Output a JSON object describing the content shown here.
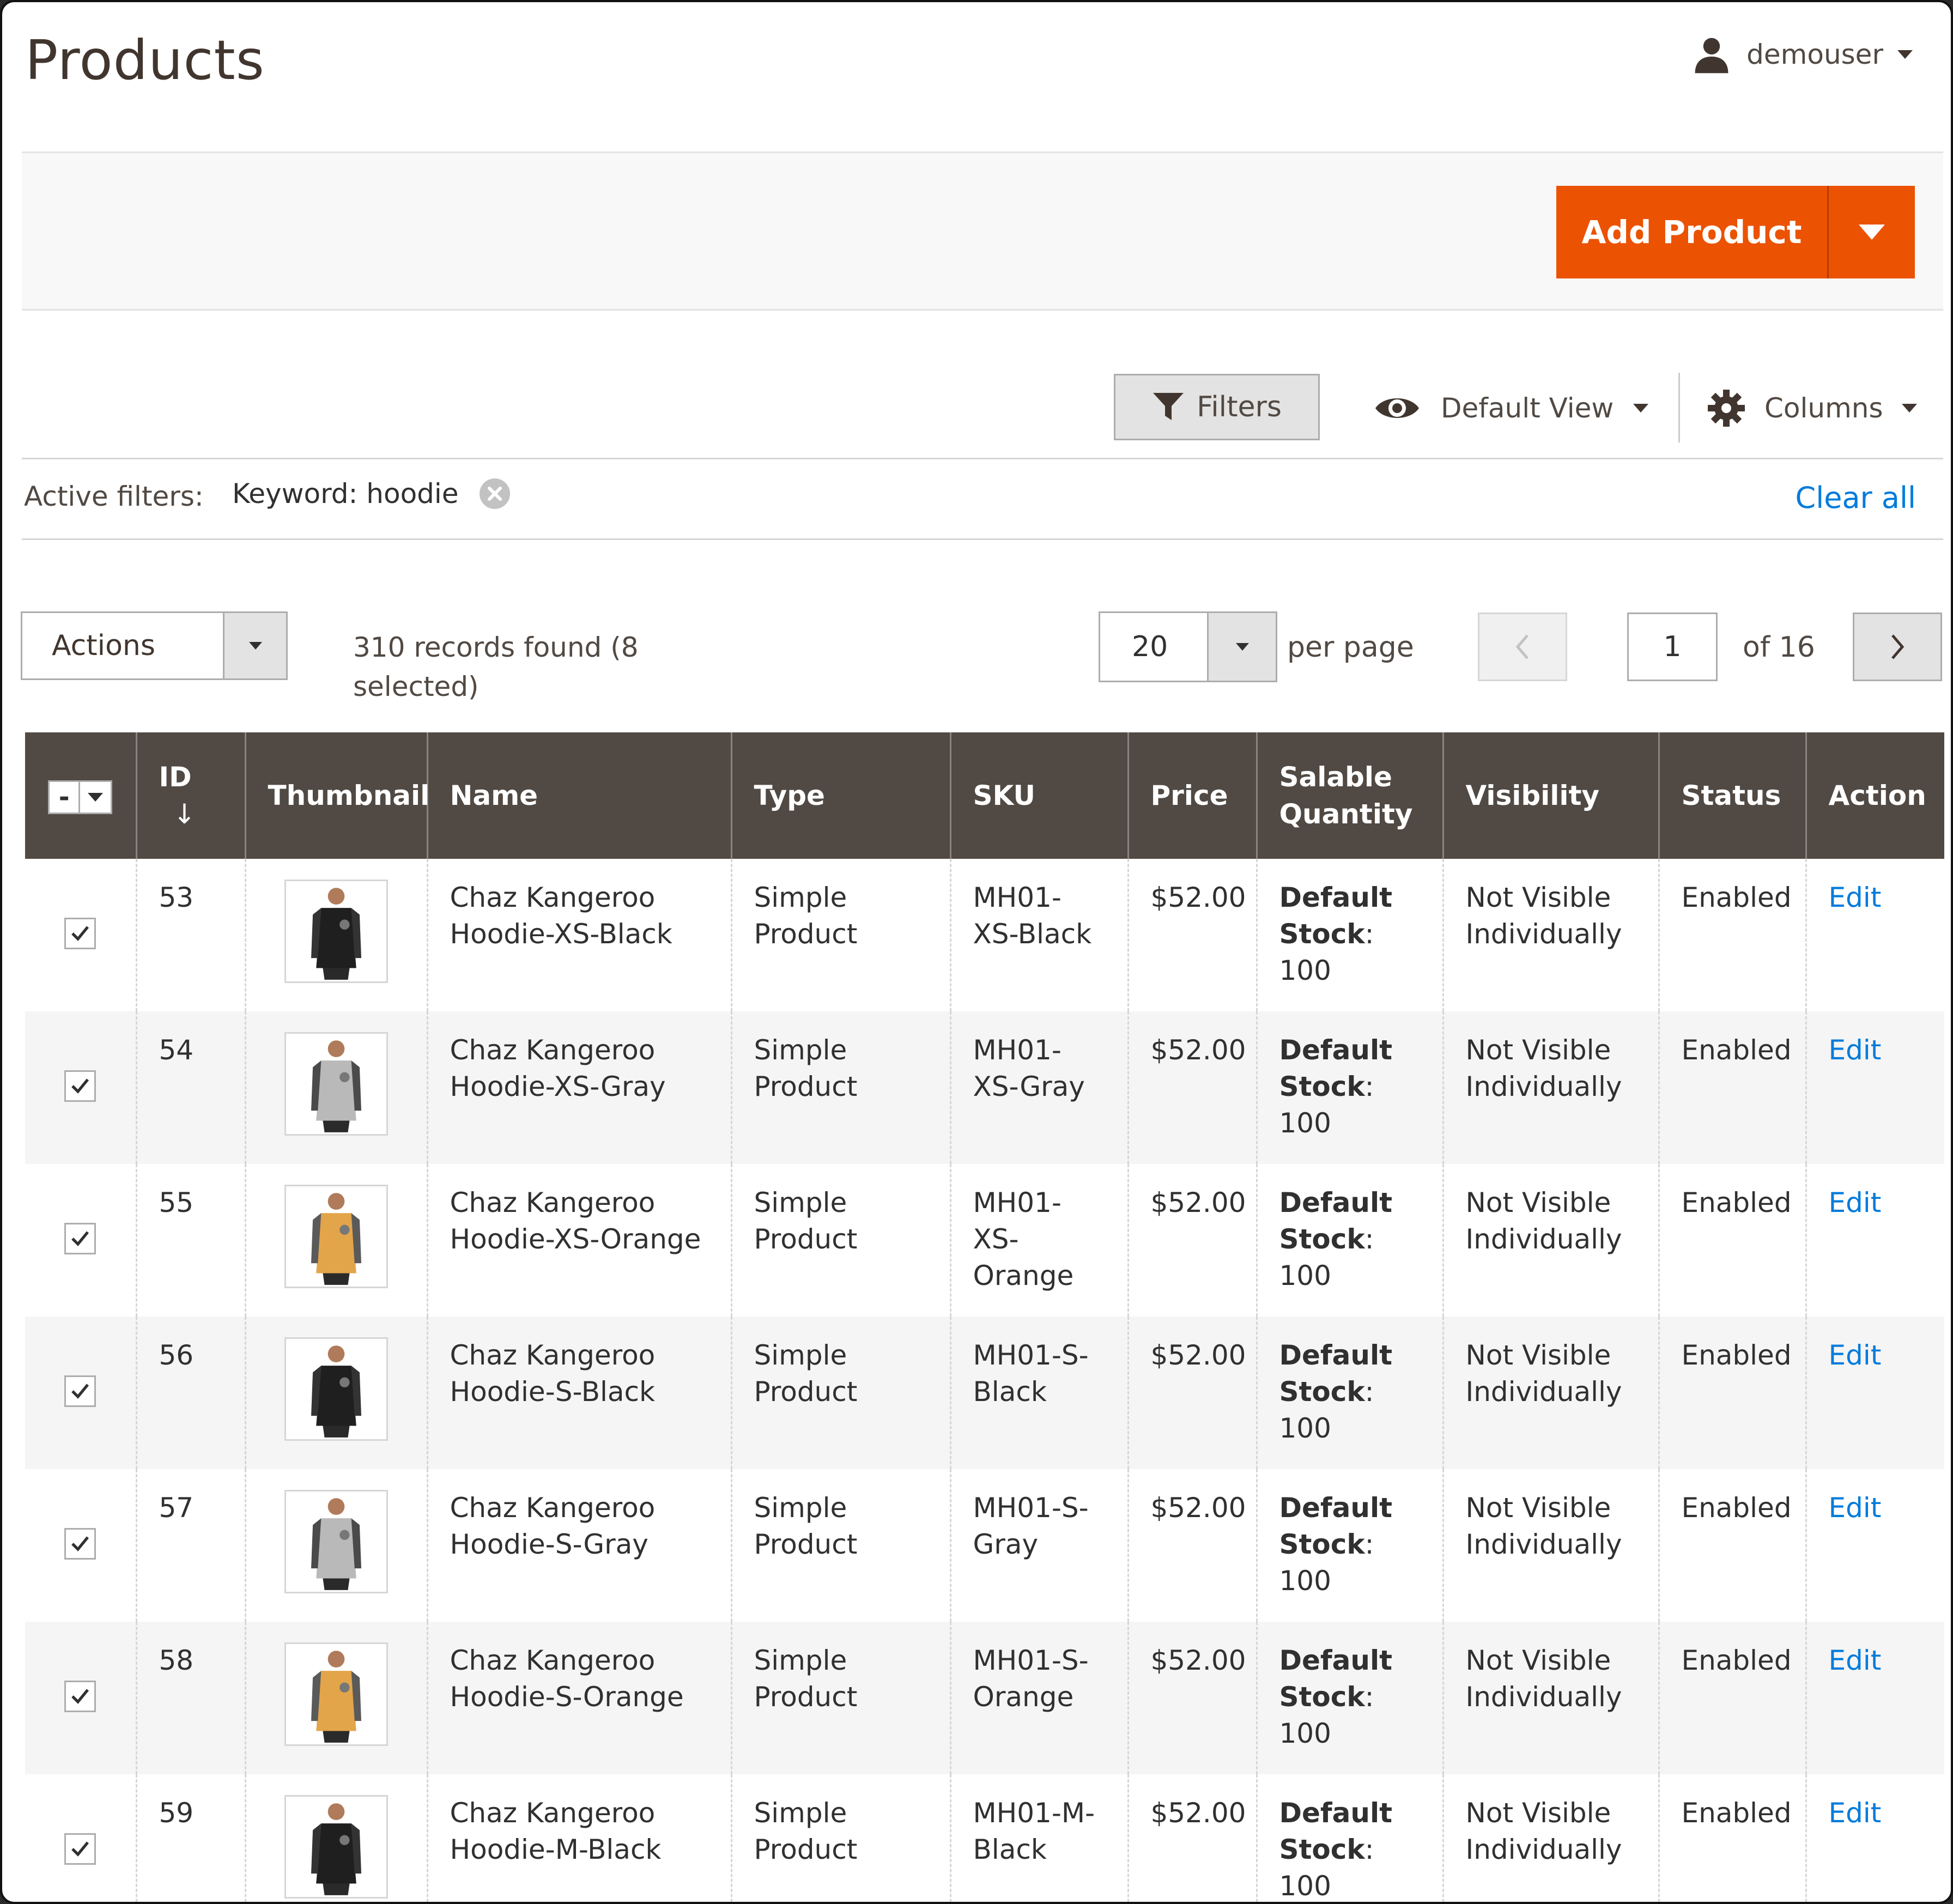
{
  "header": {
    "title": "Products",
    "user": "demouser"
  },
  "page_actions": {
    "add_product": "Add Product"
  },
  "controls": {
    "filters": "Filters",
    "view": "Default View",
    "columns": "Columns",
    "active_filters_label": "Active filters:",
    "keyword_filter": "Keyword: hoodie",
    "clear_all": "Clear all",
    "actions": "Actions",
    "records_found": "310 records found (8 selected)",
    "per_page_value": "20",
    "per_page_label": "per page",
    "current_page": "1",
    "page_of": "of 16"
  },
  "table": {
    "columns": [
      "ID",
      "Thumbnail",
      "Name",
      "Type",
      "SKU",
      "Price",
      "Salable Quantity",
      "Visibility",
      "Status",
      "Action"
    ],
    "rows": [
      {
        "id": "53",
        "name": "Chaz Kangeroo Hoodie-XS-Black",
        "type": "Simple Product",
        "sku": "MH01-XS-Black",
        "price": "$52.00",
        "qty_label": "Default Stock",
        "qty_value": ": 100",
        "visibility": "Not Visible Individually",
        "status": "Enabled",
        "action": "Edit",
        "color": "black"
      },
      {
        "id": "54",
        "name": "Chaz Kangeroo Hoodie-XS-Gray",
        "type": "Simple Product",
        "sku": "MH01-XS-Gray",
        "price": "$52.00",
        "qty_label": "Default Stock",
        "qty_value": ": 100",
        "visibility": "Not Visible Individually",
        "status": "Enabled",
        "action": "Edit",
        "color": "gray"
      },
      {
        "id": "55",
        "name": "Chaz Kangeroo Hoodie-XS-Orange",
        "type": "Simple Product",
        "sku": "MH01-XS-Orange",
        "price": "$52.00",
        "qty_label": "Default Stock",
        "qty_value": ": 100",
        "visibility": "Not Visible Individually",
        "status": "Enabled",
        "action": "Edit",
        "color": "orange"
      },
      {
        "id": "56",
        "name": "Chaz Kangeroo Hoodie-S-Black",
        "type": "Simple Product",
        "sku": "MH01-S-Black",
        "price": "$52.00",
        "qty_label": "Default Stock",
        "qty_value": ": 100",
        "visibility": "Not Visible Individually",
        "status": "Enabled",
        "action": "Edit",
        "color": "black"
      },
      {
        "id": "57",
        "name": "Chaz Kangeroo Hoodie-S-Gray",
        "type": "Simple Product",
        "sku": "MH01-S-Gray",
        "price": "$52.00",
        "qty_label": "Default Stock",
        "qty_value": ": 100",
        "visibility": "Not Visible Individually",
        "status": "Enabled",
        "action": "Edit",
        "color": "gray"
      },
      {
        "id": "58",
        "name": "Chaz Kangeroo Hoodie-S-Orange",
        "type": "Simple Product",
        "sku": "MH01-S-Orange",
        "price": "$52.00",
        "qty_label": "Default Stock",
        "qty_value": ": 100",
        "visibility": "Not Visible Individually",
        "status": "Enabled",
        "action": "Edit",
        "color": "orange"
      },
      {
        "id": "59",
        "name": "Chaz Kangeroo Hoodie-M-Black",
        "type": "Simple Product",
        "sku": "MH01-M-Black",
        "price": "$52.00",
        "qty_label": "Default Stock",
        "qty_value": ": 100",
        "visibility": "Not Visible Individually",
        "status": "Enabled",
        "action": "Edit",
        "color": "black"
      }
    ]
  },
  "colors": {
    "accent": "#eb5202",
    "link": "#007bdb",
    "header_bg": "#514943"
  },
  "icons": {
    "user": "user-icon",
    "filter": "funnel-icon",
    "view": "eye-icon",
    "columns": "gear-icon",
    "remove_filter": "close-circle-icon"
  }
}
